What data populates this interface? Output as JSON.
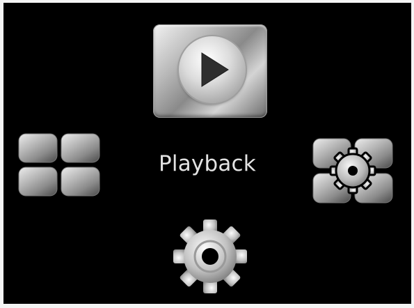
{
  "screen": {
    "mode_title": "Playback",
    "items": [
      {
        "name": "playback",
        "icon": "play-icon",
        "selected": true
      },
      {
        "name": "gallery",
        "icon": "grid-icon",
        "selected": false
      },
      {
        "name": "menu-settings",
        "icon": "settings-grid-icon",
        "selected": false
      },
      {
        "name": "setup",
        "icon": "gear-icon",
        "selected": false
      }
    ]
  },
  "colors": {
    "background": "#000000",
    "label": "#e2e2e2",
    "metal_light": "#f2f2f2",
    "metal_dark": "#6a6a6a"
  }
}
